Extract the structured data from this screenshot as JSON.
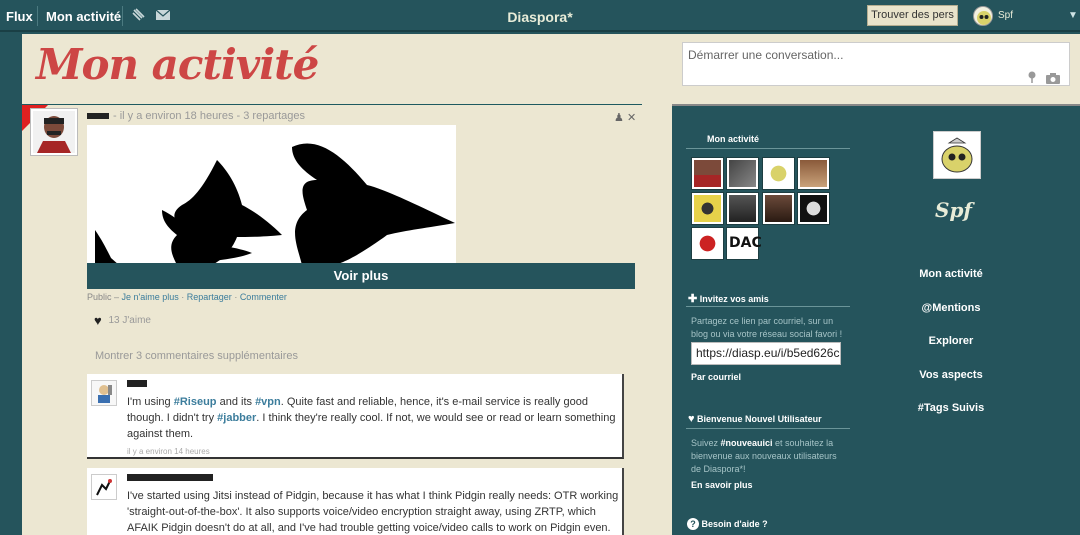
{
  "topbar": {
    "flux": "Flux",
    "mon_activite": "Mon activité",
    "brand": "Diaspora*",
    "find_people": "Trouver des pers",
    "username": "Spf"
  },
  "page": {
    "title": "Mon activité"
  },
  "post": {
    "time": "il y a environ 18 heures",
    "reshares": "3 repartages",
    "voir_plus": "Voir plus",
    "footer_public": "Public",
    "footer_dislike": "Je n'aime plus",
    "footer_reshare": "Repartager",
    "footer_comment": "Commenter",
    "likes": "13 J'aime",
    "show_comments": "Montrer 3 commentaires supplémentaires"
  },
  "comments": [
    {
      "p1": "I'm using ",
      "t1": "#Riseup",
      "p2": " and its ",
      "t2": "#vpn",
      "p3": ". Quite fast and reliable, hence, it's e-mail service is really good though. I didn't try ",
      "t3": "#jabber",
      "p4": ". I think they're really cool. If not, we would see or read or learn something against them.",
      "time": "il y a environ 14 heures"
    },
    {
      "text": "I've started using Jitsi instead of Pidgin, because it has what I think Pidgin really needs: OTR working 'straight-out-of-the-box'. It also supports voice/video encryption straight away, using ZRTP, which AFAIK Pidgin doesn't do at all, and I've had trouble getting voice/video calls to work on Pidgin even."
    }
  ],
  "publisher": {
    "placeholder": "Démarrer une conversation..."
  },
  "sidebar": {
    "aspects_title": "Mon activité",
    "invite_title": "Invitez vos amis",
    "invite_text": "Partagez ce lien par courriel, sur un blog ou via votre réseau social favori !",
    "invite_url": "https://diasp.eu/i/b5ed626c",
    "invite_email": "Par courriel",
    "welcome_title": "Bienvenue Nouvel Utilisateur",
    "welcome_pre": "Suivez ",
    "welcome_tag": "#nouveauici",
    "welcome_post": " et souhaitez la bienvenue aux nouveaux utilisateurs de Diaspora*!",
    "welcome_more": "En savoir plus",
    "help_title": "Besoin d'aide ?"
  },
  "profile": {
    "name": "Spf",
    "nav": [
      "Mon activité",
      "@Mentions",
      "Explorer",
      "Vos aspects",
      "#Tags Suivis"
    ]
  },
  "colors": {
    "brand_teal": "#25545c",
    "title_red": "#cd4645",
    "background": "#ece7d2",
    "tag_blue": "#3c7d9c"
  }
}
